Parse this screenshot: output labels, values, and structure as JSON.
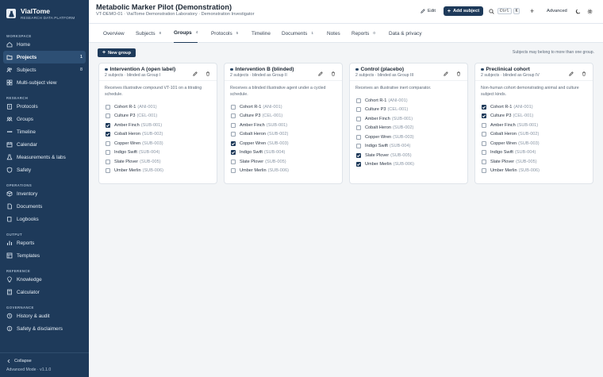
{
  "brand": {
    "name": "VialTome",
    "tagline": "RESEARCH DATA PLATFORM"
  },
  "sidebar": {
    "sections": [
      {
        "heading": "WORKSPACE",
        "items": [
          {
            "label": "Home",
            "icon": "home-icon"
          },
          {
            "label": "Projects",
            "icon": "folder-icon",
            "count": "1",
            "active": true
          },
          {
            "label": "Subjects",
            "icon": "users-icon",
            "count": "8"
          },
          {
            "label": "Multi-subject view",
            "icon": "grid-icon"
          }
        ]
      },
      {
        "heading": "RESEARCH",
        "items": [
          {
            "label": "Protocols",
            "icon": "clipboard-icon"
          },
          {
            "label": "Groups",
            "icon": "groups-icon"
          },
          {
            "label": "Timeline",
            "icon": "timeline-icon"
          },
          {
            "label": "Calendar",
            "icon": "calendar-icon"
          },
          {
            "label": "Measurements & labs",
            "icon": "flask-icon"
          },
          {
            "label": "Safety",
            "icon": "shield-icon"
          }
        ]
      },
      {
        "heading": "OPERATIONS",
        "items": [
          {
            "label": "Inventory",
            "icon": "box-icon"
          },
          {
            "label": "Documents",
            "icon": "document-icon"
          },
          {
            "label": "Logbooks",
            "icon": "book-icon"
          }
        ]
      },
      {
        "heading": "OUTPUT",
        "items": [
          {
            "label": "Reports",
            "icon": "chart-icon"
          },
          {
            "label": "Templates",
            "icon": "template-icon"
          }
        ]
      },
      {
        "heading": "REFERENCE",
        "items": [
          {
            "label": "Knowledge",
            "icon": "lightbulb-icon"
          },
          {
            "label": "Calculator",
            "icon": "calculator-icon"
          }
        ]
      },
      {
        "heading": "GOVERNANCE",
        "items": [
          {
            "label": "History & audit",
            "icon": "history-icon"
          },
          {
            "label": "Safety & disclaimers",
            "icon": "info-icon"
          }
        ]
      }
    ],
    "collapse_label": "Collapse",
    "mode_label": "Advanced Mode · v1.1.0"
  },
  "header": {
    "title": "Metabolic Marker Pilot (Demonstration)",
    "subtitle": "VT-DEMO-01 · VialTome Demonstration Laboratory · Demonstration Investigator",
    "edit_label": "Edit",
    "add_subject_label": "Add subject",
    "kbd_1": "Ctrl",
    "kbd_2": "K",
    "plus_label": "+",
    "advanced_label": "Advanced"
  },
  "tabs": [
    {
      "label": "Overview"
    },
    {
      "label": "Subjects",
      "count": "8"
    },
    {
      "label": "Groups",
      "count": "4",
      "active": true
    },
    {
      "label": "Protocols",
      "count": "5"
    },
    {
      "label": "Timeline"
    },
    {
      "label": "Documents",
      "count": "1"
    },
    {
      "label": "Notes"
    },
    {
      "label": "Reports",
      "count": "0"
    },
    {
      "label": "Data & privacy"
    }
  ],
  "toolbar": {
    "new_group_label": "New group",
    "hint": "Subjects may belong to more than one group."
  },
  "subjects": [
    {
      "name": "Cohort R-1",
      "code": "(ANI-001)"
    },
    {
      "name": "Culture P3",
      "code": "(CEL-001)"
    },
    {
      "name": "Amber Finch",
      "code": "(SUB-001)"
    },
    {
      "name": "Cobalt Heron",
      "code": "(SUB-002)"
    },
    {
      "name": "Copper Wren",
      "code": "(SUB-003)"
    },
    {
      "name": "Indigo Swift",
      "code": "(SUB-004)"
    },
    {
      "name": "Slate Plover",
      "code": "(SUB-005)"
    },
    {
      "name": "Umber Merlin",
      "code": "(SUB-006)"
    }
  ],
  "groups": [
    {
      "title": "Intervention A (open label)",
      "meta": "2 subjects · blinded as Group I",
      "description": "Receives illustrative compound VT-101 on a titrating schedule.",
      "checked": [
        false,
        false,
        true,
        true,
        false,
        false,
        false,
        false
      ]
    },
    {
      "title": "Intervention B (blinded)",
      "meta": "2 subjects · blinded as Group II",
      "description": "Receives a blinded illustrative agent under a cycled schedule.",
      "checked": [
        false,
        false,
        false,
        false,
        true,
        true,
        false,
        false
      ]
    },
    {
      "title": "Control (placebo)",
      "meta": "2 subjects · blinded as Group III",
      "description": "Receives an illustrative inert comparator.",
      "checked": [
        false,
        false,
        false,
        false,
        false,
        false,
        true,
        true
      ]
    },
    {
      "title": "Preclinical cohort",
      "meta": "2 subjects · blinded as Group IV",
      "description": "Non-human cohort demonstrating animal and culture subject kinds.",
      "checked": [
        true,
        true,
        false,
        false,
        false,
        false,
        false,
        false
      ]
    }
  ]
}
